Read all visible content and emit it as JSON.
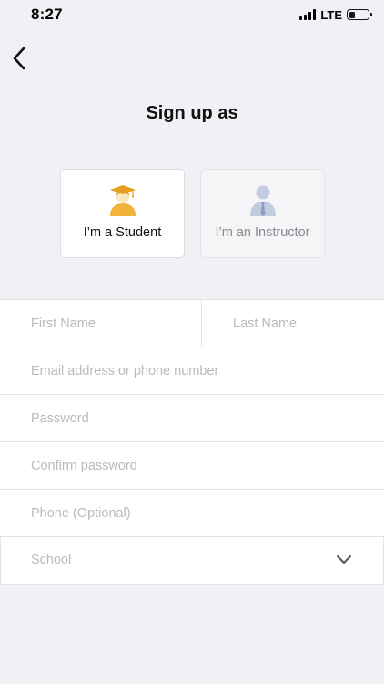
{
  "status_bar": {
    "time": "8:27",
    "network": "LTE",
    "battery_level": 0.3
  },
  "header": {
    "back_icon": "chevron-left-icon",
    "title": "Sign up as"
  },
  "roles": [
    {
      "label": "I’m a Student",
      "icon": "graduate-icon",
      "selected": true,
      "accent": "#f2b33d"
    },
    {
      "label": "I’m an Instructor",
      "icon": "instructor-icon",
      "selected": false,
      "accent": "#c3cbe0"
    }
  ],
  "form": {
    "first_name_placeholder": "First Name",
    "last_name_placeholder": "Last Name",
    "email_placeholder": "Email address or phone number",
    "password_placeholder": "Password",
    "confirm_password_placeholder": "Confirm password",
    "phone_placeholder": "Phone (Optional)",
    "school_placeholder": "School",
    "school_icon": "chevron-down-icon"
  }
}
